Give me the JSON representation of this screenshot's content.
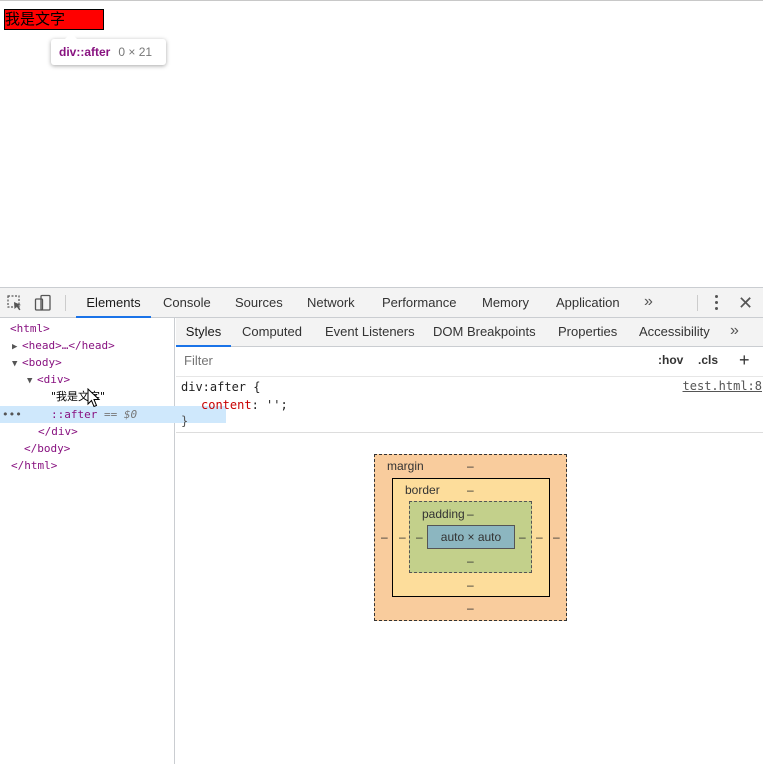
{
  "page": {
    "red_box_text": "我是文字"
  },
  "tooltip": {
    "selector": "div::after",
    "size": "0 × 21"
  },
  "devtools": {
    "main_tabs": [
      "Elements",
      "Console",
      "Sources",
      "Network",
      "Performance",
      "Memory",
      "Application"
    ],
    "active_main_tab": "Elements",
    "more_tabs_glyph": "»",
    "close_glyph": "✕",
    "dom": {
      "html_open": "<html>",
      "head": "<head>…</head>",
      "body_open": "<body>",
      "div_open": "<div>",
      "text_node": "\"我是文字\"",
      "pseudo": "::after",
      "pseudo_ref": "== $0",
      "div_close": "</div>",
      "body_close": "</body>",
      "html_close": "</html>",
      "dots": "•••"
    },
    "sub_tabs": [
      "Styles",
      "Computed",
      "Event Listeners",
      "DOM Breakpoints",
      "Properties",
      "Accessibility"
    ],
    "active_sub_tab": "Styles",
    "filter_placeholder": "Filter",
    "hov": ":hov",
    "cls": ".cls",
    "plus": "+",
    "rule": {
      "selector": "div:after",
      "open_brace": " {",
      "property": "content",
      "colon": ": ",
      "value": "'';",
      "close_brace": "}",
      "source": "test.html:8"
    },
    "box_model": {
      "margin_label": "margin",
      "border_label": "border",
      "padding_label": "padding",
      "dash": "–",
      "content": "auto × auto"
    }
  },
  "colors": {
    "accent": "#1a73e8",
    "tag": "#881280",
    "selected_row": "#cfe8fc",
    "margin": "#f9cc9d",
    "border": "#fddd9b",
    "padding": "#c3d08b",
    "content": "#8cb6c0"
  }
}
